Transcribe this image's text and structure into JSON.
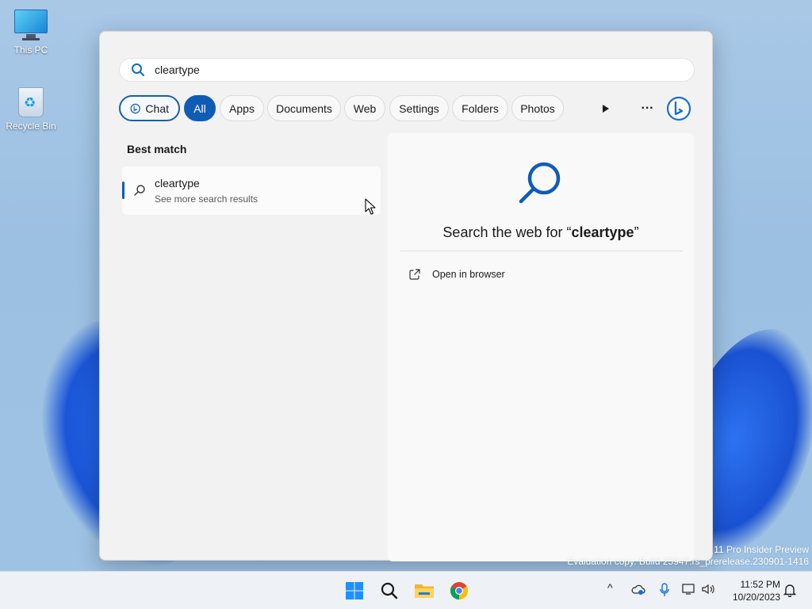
{
  "desktop": {
    "icons": [
      {
        "label": "This PC",
        "icon": "monitor-icon"
      },
      {
        "label": "Recycle Bin",
        "icon": "recycle-bin-icon"
      }
    ],
    "watermark_line1": "11 Pro Insider Preview",
    "watermark_line2": "Evaluation copy. Build 25947.rs_prerelease.230901-1416"
  },
  "search": {
    "query": "cleartype",
    "icon": "search-icon"
  },
  "filters": {
    "chips": [
      {
        "label": "Chat",
        "icon": "bing-chat-icon"
      },
      {
        "label": "All",
        "selected": true
      },
      {
        "label": "Apps"
      },
      {
        "label": "Documents"
      },
      {
        "label": "Web"
      },
      {
        "label": "Settings"
      },
      {
        "label": "Folders"
      },
      {
        "label": "Photos"
      }
    ],
    "more_icon": "play-arrow-icon",
    "overflow_label": "···",
    "bing_icon": "bing-icon"
  },
  "results": {
    "section_title": "Best match",
    "best_match": {
      "title": "cleartype",
      "subtitle": "See more search results",
      "icon": "search-icon"
    }
  },
  "preview": {
    "title_prefix": "Search the web for “",
    "title_query": "cleartype",
    "title_suffix": "”",
    "action_label": "Open in browser",
    "action_icon": "open-external-icon"
  },
  "taskbar": {
    "apps": [
      "windows-start-icon",
      "search-icon",
      "file-explorer-icon",
      "chrome-icon"
    ],
    "tray_chevron": "^",
    "time": "11:52 PM",
    "date": "10/20/2023"
  },
  "colors": {
    "accent": "#0f5cb5",
    "panel_bg": "#f2f2f2",
    "desktop_bg": "#a9c8e6"
  }
}
